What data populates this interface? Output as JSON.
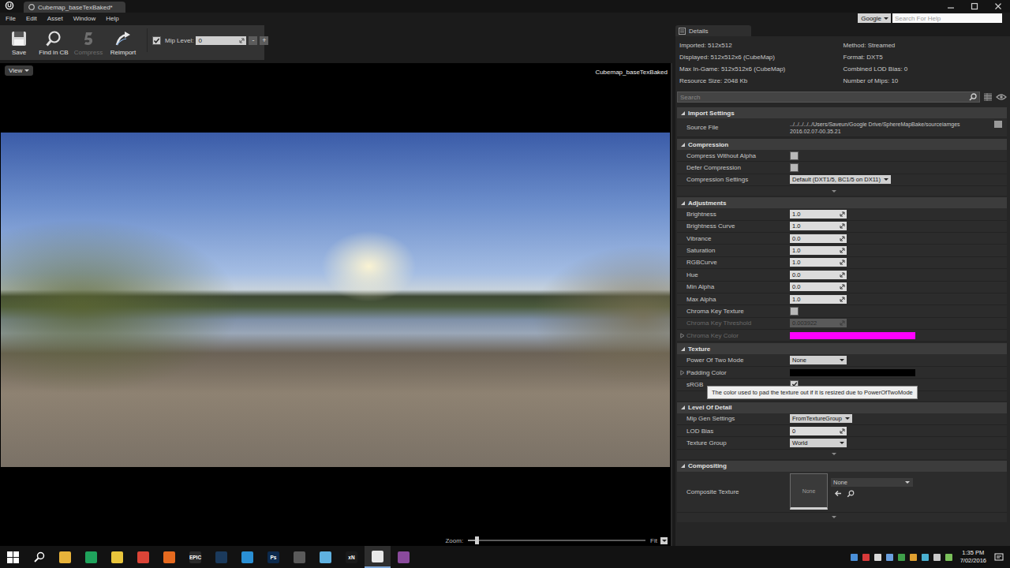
{
  "title_bar": {
    "tab": "Cubemap_baseTexBaked*"
  },
  "menu": [
    {
      "label": "File"
    },
    {
      "label": "Edit"
    },
    {
      "label": "Asset"
    },
    {
      "label": "Window"
    },
    {
      "label": "Help"
    }
  ],
  "help_search": {
    "engine": "Google",
    "placeholder": "Search For Help"
  },
  "toolbar": {
    "buttons": [
      {
        "label": "Save",
        "disabled": false
      },
      {
        "label": "Find in CB",
        "disabled": false
      },
      {
        "label": "Compress",
        "disabled": true
      },
      {
        "label": "Reimport",
        "disabled": false
      }
    ],
    "mip": {
      "enabled": true,
      "label": "Mip Level:",
      "value": "0",
      "decrement": "-",
      "increment": "+"
    }
  },
  "viewport": {
    "view_button": "View",
    "texture_name": "Cubemap_baseTexBaked",
    "zoom_label": "Zoom:",
    "zoom_level": 0.05,
    "fit": "Fit"
  },
  "details": {
    "tab": "Details",
    "info_left": [
      "Imported: 512x512",
      "Displayed: 512x512x6 (CubeMap)",
      "Max In-Game: 512x512x6 (CubeMap)",
      "Resource Size: 2048 Kb"
    ],
    "info_right": [
      "Method: Streamed",
      "Format: DXT5",
      "Combined LOD Bias: 0",
      "Number of Mips: 10"
    ],
    "search_placeholder": "Search",
    "sections": [
      {
        "title": "Import Settings",
        "expanded": true,
        "has_advanced": false,
        "rows": [
          {
            "kind": "file",
            "label": "Source File",
            "value": "../../../../../Users/Saveun/Google Drive/SphereMapBake/sourceiamges",
            "timestamp": "2016.02.07-00.35.21",
            "disabled": false,
            "expandable": false
          }
        ]
      },
      {
        "title": "Compression",
        "expanded": true,
        "has_advanced": true,
        "rows": [
          {
            "kind": "checkbox",
            "label": "Compress Without Alpha",
            "checked": false,
            "disabled": false,
            "expandable": false
          },
          {
            "kind": "checkbox",
            "label": "Defer Compression",
            "checked": false,
            "disabled": false,
            "expandable": false
          },
          {
            "kind": "dropdown",
            "label": "Compression Settings",
            "value": "Default (DXT1/5, BC1/5 on DX11)",
            "disabled": false,
            "expandable": false
          }
        ]
      },
      {
        "title": "Adjustments",
        "expanded": true,
        "has_advanced": false,
        "rows": [
          {
            "kind": "number",
            "label": "Brightness",
            "value": "1.0",
            "disabled": false,
            "expandable": false
          },
          {
            "kind": "number",
            "label": "Brightness Curve",
            "value": "1.0",
            "disabled": false,
            "expandable": false
          },
          {
            "kind": "number",
            "label": "Vibrance",
            "value": "0.0",
            "disabled": false,
            "expandable": false
          },
          {
            "kind": "number",
            "label": "Saturation",
            "value": "1.0",
            "disabled": false,
            "expandable": false
          },
          {
            "kind": "number",
            "label": "RGBCurve",
            "value": "1.0",
            "disabled": false,
            "expandable": false
          },
          {
            "kind": "number",
            "label": "Hue",
            "value": "0.0",
            "disabled": false,
            "expandable": false
          },
          {
            "kind": "number",
            "label": "Min Alpha",
            "value": "0.0",
            "disabled": false,
            "expandable": false
          },
          {
            "kind": "number",
            "label": "Max Alpha",
            "value": "1.0",
            "disabled": false,
            "expandable": false
          },
          {
            "kind": "checkbox",
            "label": "Chroma Key Texture",
            "checked": false,
            "disabled": false,
            "expandable": false
          },
          {
            "kind": "number",
            "label": "Chroma Key Threshold",
            "value": "0.003922",
            "disabled": true,
            "expandable": false
          },
          {
            "kind": "color",
            "label": "Chroma Key Color",
            "color": "#ff00ff",
            "disabled": true,
            "expandable": true
          }
        ]
      },
      {
        "title": "Texture",
        "expanded": true,
        "has_advanced": true,
        "rows": [
          {
            "kind": "dropdown",
            "label": "Power Of Two Mode",
            "value": "None",
            "disabled": false,
            "expandable": false
          },
          {
            "kind": "color",
            "label": "Padding Color",
            "color": "#000000",
            "disabled": false,
            "expandable": true
          },
          {
            "kind": "checkbox",
            "label": "sRGB",
            "checked": true,
            "disabled": false,
            "expandable": false
          }
        ]
      },
      {
        "title": "Level Of Detail",
        "expanded": true,
        "has_advanced": true,
        "rows": [
          {
            "kind": "dropdown",
            "label": "Mip Gen Settings",
            "value": "FromTextureGroup",
            "disabled": false,
            "expandable": false
          },
          {
            "kind": "number",
            "label": "LOD Bias",
            "value": "0",
            "disabled": false,
            "expandable": false
          },
          {
            "kind": "dropdown",
            "label": "Texture Group",
            "value": "World",
            "disabled": false,
            "expandable": false
          }
        ]
      },
      {
        "title": "Compositing",
        "expanded": true,
        "has_advanced": true,
        "rows": [
          {
            "kind": "asset",
            "label": "Composite Texture",
            "thumbnail": "None",
            "value": "None",
            "disabled": false,
            "expandable": false
          }
        ]
      }
    ]
  },
  "tooltip": {
    "text": "The color used to pad the texture out if it is resized due to PowerOfTwoMode"
  },
  "taskbar": {
    "apps": [
      {
        "glyph": "",
        "color": "#e8b33a",
        "active": false
      },
      {
        "glyph": "",
        "color": "#1fa35c",
        "active": false
      },
      {
        "glyph": "",
        "color": "#e9c53c",
        "active": false
      },
      {
        "glyph": "",
        "color": "#db4437",
        "active": false
      },
      {
        "glyph": "",
        "color": "#e66a1f",
        "active": false
      },
      {
        "glyph": "EPIC",
        "color": "#2a2a2a",
        "active": false
      },
      {
        "glyph": "",
        "color": "#1b3a5c",
        "active": false
      },
      {
        "glyph": "",
        "color": "#2a8fd4",
        "active": false
      },
      {
        "glyph": "Ps",
        "color": "#0c2a4d",
        "active": false
      },
      {
        "glyph": "",
        "color": "#5a5a5a",
        "active": false
      },
      {
        "glyph": "",
        "color": "#5fb1e0",
        "active": false
      },
      {
        "glyph": "xN",
        "color": "#1a1a1a",
        "active": false
      },
      {
        "glyph": "",
        "color": "#e8e8e8",
        "active": true
      },
      {
        "glyph": "",
        "color": "#8a4a9c",
        "active": false
      }
    ],
    "tray": [
      {
        "color": "#4a8fd8"
      },
      {
        "color": "#d83a3a"
      },
      {
        "color": "#d8d8d8"
      },
      {
        "color": "#6aa0e0"
      },
      {
        "color": "#3fa04a"
      },
      {
        "color": "#e0a030"
      },
      {
        "color": "#4ab0d0"
      },
      {
        "color": "#c8c8c8"
      },
      {
        "color": "#7ac05a"
      }
    ],
    "time": "1:35 PM",
    "date": "7/02/2016"
  }
}
